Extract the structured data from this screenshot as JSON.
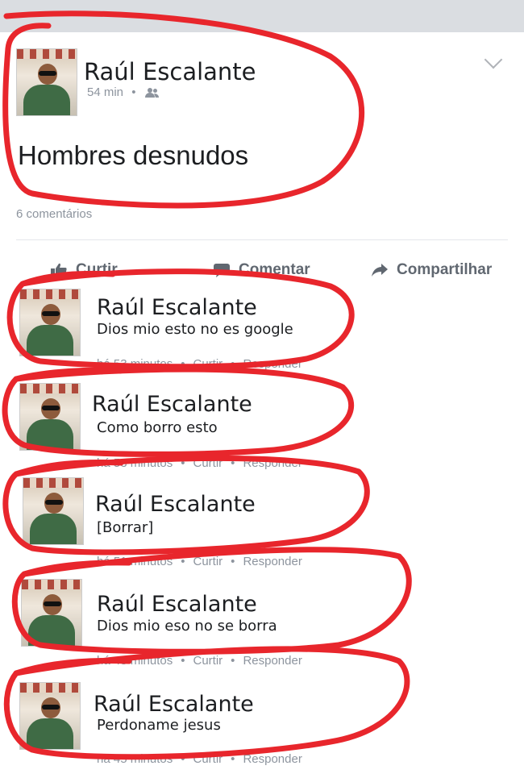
{
  "post": {
    "author": "Raúl Escalante",
    "time": "54 min",
    "text": "Hombres desnudos",
    "comments_count": "6 comentários"
  },
  "actions": {
    "like": "Curtir",
    "comment": "Comentar",
    "share": "Compartilhar"
  },
  "comments": [
    {
      "author": "Raúl Escalante",
      "text": "Dios mio esto no es google",
      "time": "há 53 minutos",
      "like": "Curtir",
      "reply": "Responder"
    },
    {
      "author": "Raúl Escalante",
      "text": "Como borro esto",
      "time": "há 53 minutos",
      "like": "Curtir",
      "reply": "Responder"
    },
    {
      "author": "Raúl Escalante",
      "text": "[Borrar]",
      "time": "há 51 minutos",
      "like": "Curtir",
      "reply": "Responder"
    },
    {
      "author": "Raúl Escalante",
      "text": "Dios mio eso no se borra",
      "time": "há 48 minutos",
      "like": "Curtir",
      "reply": "Responder"
    },
    {
      "author": "Raúl Escalante",
      "text": "Perdoname jesus",
      "time": "há 45 minutos",
      "like": "Curtir",
      "reply": "Responder"
    }
  ],
  "colors": {
    "annotation_red": "#e8262c",
    "text_primary": "#1c1e21",
    "text_secondary": "#8d949e"
  }
}
